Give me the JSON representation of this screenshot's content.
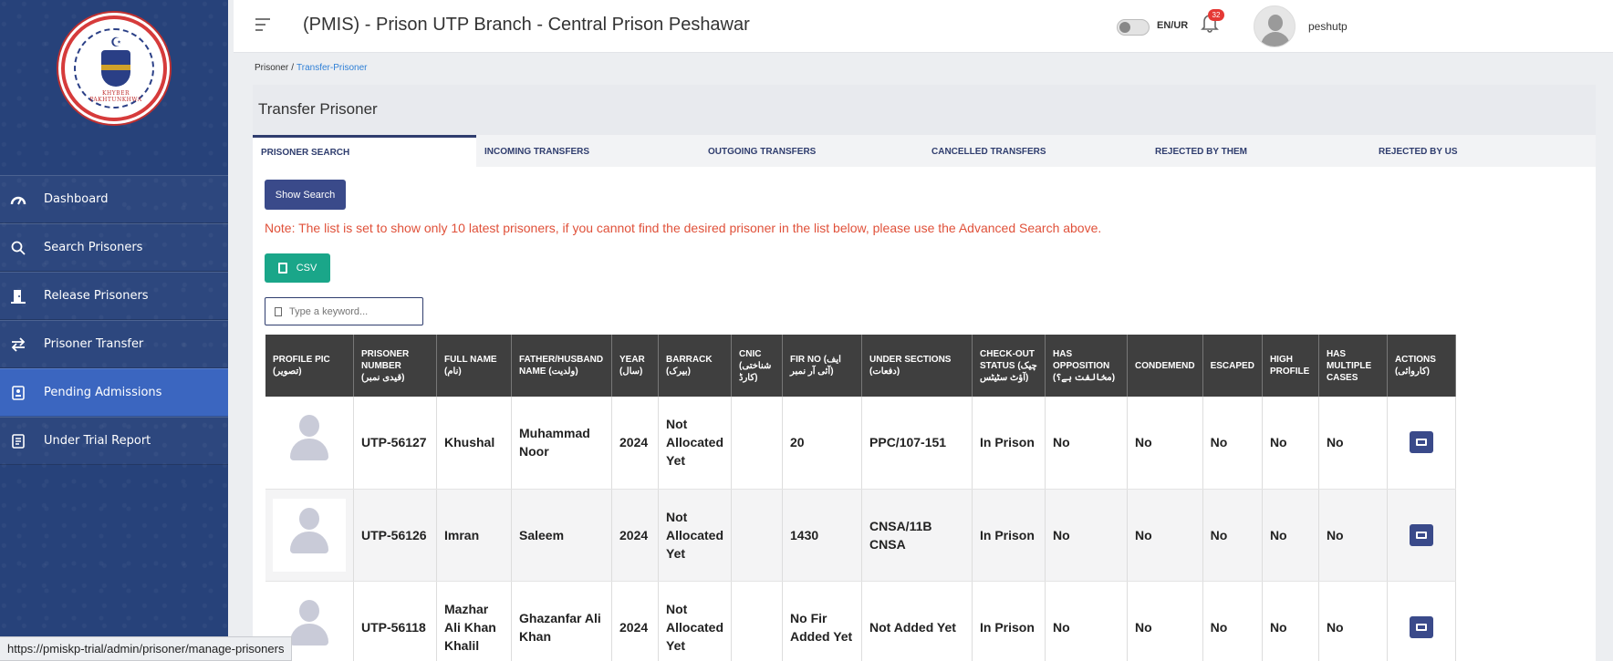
{
  "header": {
    "title": "(PMIS) - Prison UTP Branch - Central Prison Peshawar",
    "language_toggle": "EN/UR",
    "notification_count": "32",
    "username": "peshutp"
  },
  "logo": {
    "text": "KHYBER PAKHTUNKHWA"
  },
  "sidebar": {
    "items": [
      {
        "label": "Dashboard",
        "icon": "speedometer-icon"
      },
      {
        "label": "Search Prisoners",
        "icon": "search-icon"
      },
      {
        "label": "Release Prisoners",
        "icon": "door-exit-icon"
      },
      {
        "label": "Prisoner Transfer",
        "icon": "transfer-arrows-icon"
      },
      {
        "label": "Pending Admissions",
        "icon": "id-card-icon"
      },
      {
        "label": "Under Trial Report",
        "icon": "report-icon"
      }
    ],
    "active_index": 4
  },
  "breadcrumb": {
    "root": "Prisoner",
    "separator": "/",
    "current": "Transfer-Prisoner"
  },
  "page": {
    "section_title": "Transfer Prisoner",
    "tabs": [
      "PRISONER SEARCH",
      "INCOMING TRANSFERS",
      "OUTGOING TRANSFERS",
      "CANCELLED TRANSFERS",
      "REJECTED BY THEM",
      "REJECTED BY US"
    ],
    "active_tab": 0,
    "show_search_label": "Show Search",
    "note": "Note: The list is set to show only 10 latest prisoners, if you cannot find the desired prisoner in the list below, please use the Advanced Search above.",
    "csv_label": "CSV",
    "search_placeholder": "Type a keyword..."
  },
  "table": {
    "columns": [
      {
        "en": "PROFILE PIC",
        "ur": "(تصویر)"
      },
      {
        "en": "PRISONER NUMBER",
        "ur": "(قیدی نمبر)"
      },
      {
        "en": "FULL NAME",
        "ur": "(نام)"
      },
      {
        "en": "FATHER/HUSBAND NAME",
        "ur": "(ولدیت)"
      },
      {
        "en": "YEAR",
        "ur": "(سال)"
      },
      {
        "en": "BARRACK",
        "ur": "(بیرک)"
      },
      {
        "en": "CNIC",
        "ur": "(شناختی کارڈ)"
      },
      {
        "en": "FIR NO",
        "ur": "(ایف آئی آر نمبر)"
      },
      {
        "en": "UNDER SECTIONS",
        "ur": "(دفعات)"
      },
      {
        "en": "CHECK-OUT STATUS",
        "ur": "(چیک آؤٹ سٹیٹس)"
      },
      {
        "en": "HAS OPPOSITION",
        "ur": "(مخالفت ہے؟)"
      },
      {
        "en": "CONDEMEND",
        "ur": ""
      },
      {
        "en": "ESCAPED",
        "ur": ""
      },
      {
        "en": "HIGH PROFILE",
        "ur": ""
      },
      {
        "en": "HAS MULTIPLE CASES",
        "ur": ""
      },
      {
        "en": "ACTIONS",
        "ur": "(کاروائی)"
      }
    ],
    "rows": [
      {
        "prisoner_number": "UTP-56127",
        "full_name": "Khushal",
        "father_name": "Muhammad Noor",
        "year": "2024",
        "barrack": "Not Allocated Yet",
        "cnic": "",
        "fir_no": "20",
        "under_sections": "PPC/107-151",
        "checkout_status": "In Prison",
        "has_opposition": "No",
        "condemend": "No",
        "escaped": "No",
        "high_profile": "No",
        "multiple_cases": "No"
      },
      {
        "prisoner_number": "UTP-56126",
        "full_name": "Imran",
        "father_name": "Saleem",
        "year": "2024",
        "barrack": "Not Allocated Yet",
        "cnic": "",
        "fir_no": "1430",
        "under_sections": "CNSA/11B CNSA",
        "checkout_status": "In Prison",
        "has_opposition": "No",
        "condemend": "No",
        "escaped": "No",
        "high_profile": "No",
        "multiple_cases": "No"
      },
      {
        "prisoner_number": "UTP-56118",
        "full_name": "Mazhar Ali Khan Khalil",
        "father_name": "Ghazanfar Ali Khan",
        "year": "2024",
        "barrack": "Not Allocated Yet",
        "cnic": "",
        "fir_no": "No Fir Added Yet",
        "under_sections": "Not Added Yet",
        "checkout_status": "In Prison",
        "has_opposition": "No",
        "condemend": "No",
        "escaped": "No",
        "high_profile": "No",
        "multiple_cases": "No"
      }
    ]
  },
  "statusbar": {
    "url": "https://pmiskp-trial/admin/prisoner/manage-prisoners"
  }
}
